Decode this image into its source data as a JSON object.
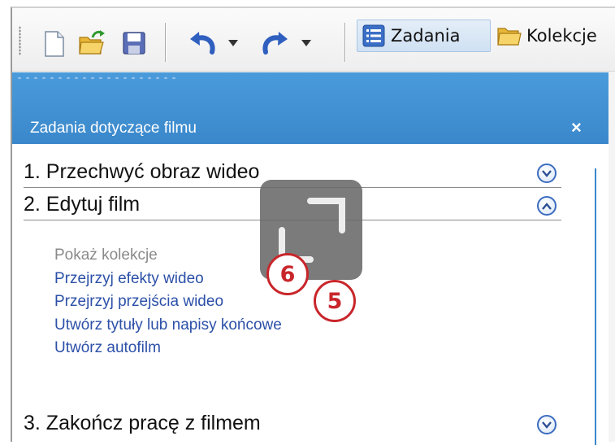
{
  "toolbar": {
    "zadania_label": "Zadania",
    "kolekcje_label": "Kolekcje"
  },
  "panel": {
    "title": "Zadania dotyczące filmu",
    "close_glyph": "×"
  },
  "sections": [
    {
      "label": "1. Przechwyć obraz wideo",
      "state": "collapsed"
    },
    {
      "label": "2. Edytuj film",
      "state": "expanded"
    },
    {
      "label": "3. Zakończ pracę z filmem",
      "state": "collapsed"
    }
  ],
  "edit_links": [
    {
      "label": "Pokaż kolekcje",
      "enabled": false
    },
    {
      "label": "Przejrzyj efekty wideo",
      "enabled": true
    },
    {
      "label": "Przejrzyj przejścia wideo",
      "enabled": true
    },
    {
      "label": "Utwórz tytuły lub napisy końcowe",
      "enabled": true
    },
    {
      "label": "Utwórz autofilm",
      "enabled": true
    }
  ],
  "callouts": [
    {
      "number": "6"
    },
    {
      "number": "5"
    }
  ],
  "colors": {
    "header_blue": "#4393d6",
    "link_blue": "#2c50a8",
    "callout_red": "#c8262b"
  },
  "icons": [
    "new-file-icon",
    "open-folder-icon",
    "save-icon",
    "undo-icon",
    "redo-icon",
    "tasks-icon",
    "collections-folder-icon",
    "chevron-down-icon",
    "chevron-up-icon"
  ]
}
